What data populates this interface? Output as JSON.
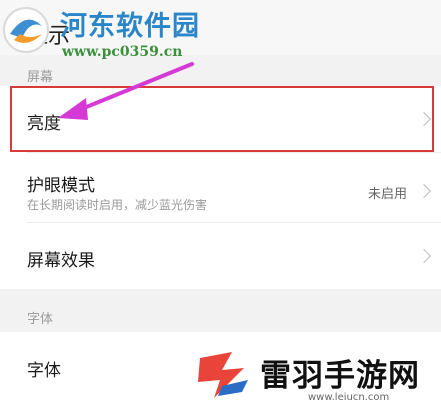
{
  "header": {
    "back_title": "显示",
    "watermark_site": "河东软件园",
    "watermark_url": "www.pc0359.cn"
  },
  "sections": {
    "screen_label": "屏幕",
    "font_label": "字体"
  },
  "rows": {
    "brightness": {
      "title": "亮度"
    },
    "eye_care": {
      "title": "护眼模式",
      "subtitle": "在长期阅读时启用，减少蓝光伤害",
      "value": "未启用"
    },
    "screen_effect": {
      "title": "屏幕效果"
    },
    "font": {
      "title": "字体"
    }
  },
  "watermark_bottom": {
    "brand": "雷羽手游网",
    "url": "www.leiucn.com"
  },
  "colors": {
    "highlight": "#d83a3a",
    "arrow": "#d63ad6",
    "site_blue": "#2a86c9",
    "url_green": "#3a8f3a",
    "brand_red": "#e8443a"
  }
}
